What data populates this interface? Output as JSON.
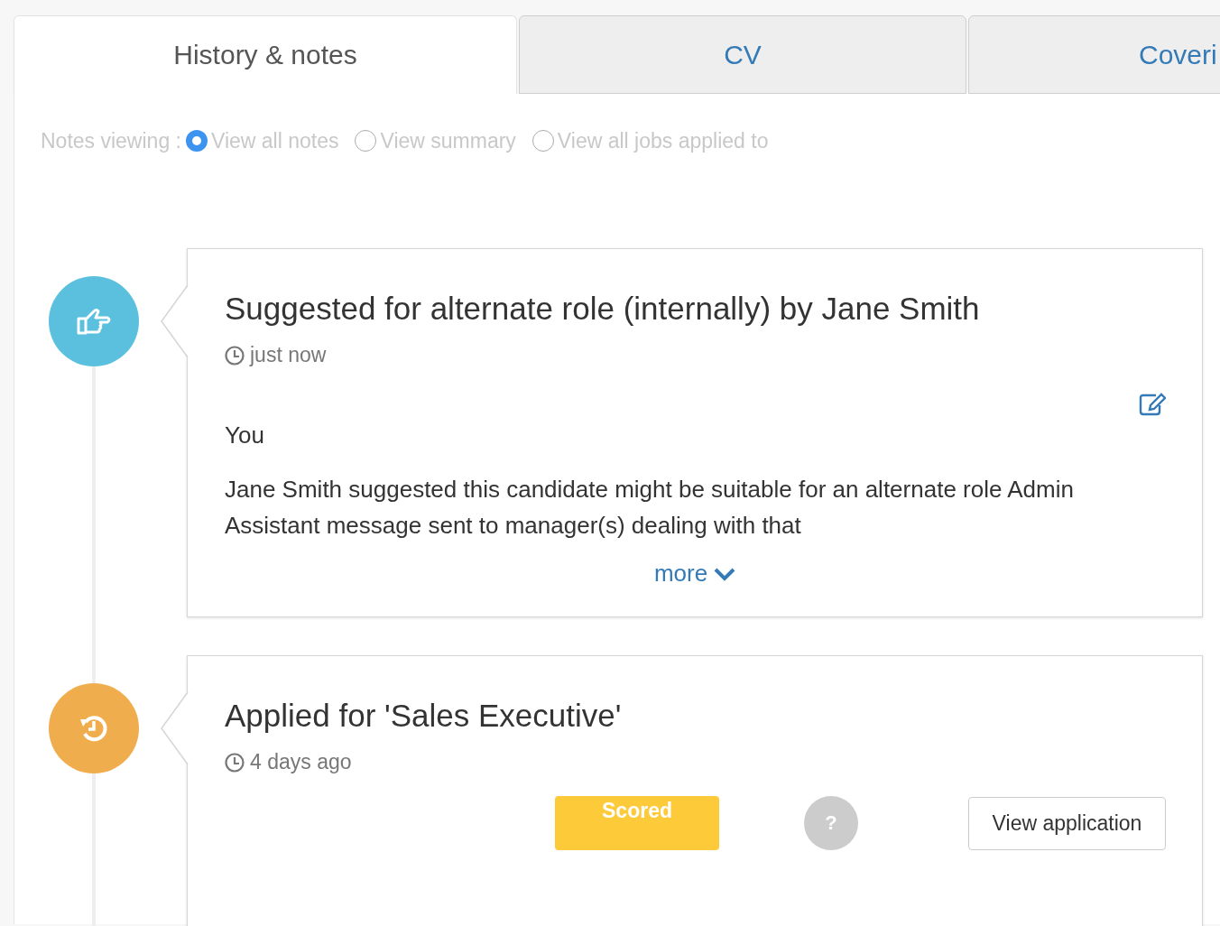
{
  "tabs": [
    {
      "label": "History & notes",
      "selected": true
    },
    {
      "label": "CV",
      "selected": false
    },
    {
      "label": "Coveri",
      "selected": false
    }
  ],
  "notes_viewing": {
    "label": "Notes viewing :",
    "options": [
      {
        "label": "View all notes",
        "selected": true
      },
      {
        "label": "View summary",
        "selected": false
      },
      {
        "label": "View all jobs applied to",
        "selected": false
      }
    ]
  },
  "timeline": [
    {
      "kind": "suggested",
      "color": "#5bc0de",
      "title": "Suggested for alternate role (internally) by Jane Smith",
      "time": "just now",
      "editable": true,
      "author": "You",
      "body": "Jane Smith suggested this candidate might be suitable for an alternate role Admin Assistant message sent to manager(s) dealing with that",
      "more": "more"
    },
    {
      "kind": "applied",
      "color": "#f0ad4e",
      "title": "Applied for 'Sales Executive'",
      "time": "4 days ago",
      "editable": false,
      "badge": "Scored",
      "help": "?",
      "button": "View application"
    }
  ]
}
